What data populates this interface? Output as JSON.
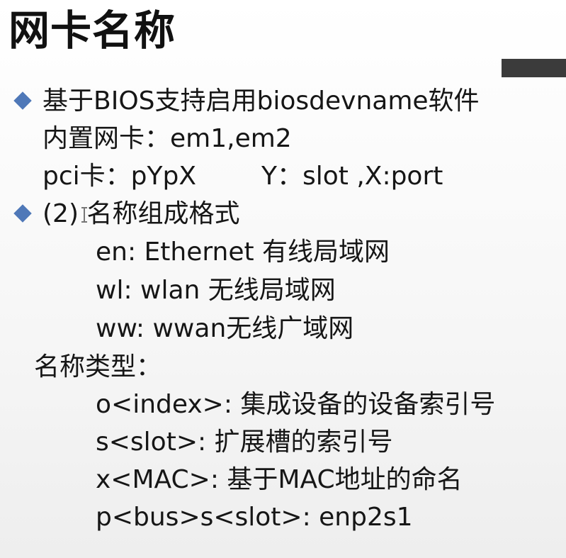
{
  "slide": {
    "title": "网卡名称",
    "lines": {
      "l1": "基于BIOS支持启用biosdevname软件",
      "l2": "内置网卡：em1,em2",
      "l3a": "pci卡：pYpX",
      "l3b": "Y：slot ,X:port",
      "l4": "(2) 名称组成格式",
      "l5": "en: Ethernet 有线局域网",
      "l6": "wl: wlan 无线局域网",
      "l7": "ww: wwan无线广域网",
      "l8": "名称类型：",
      "l9": "o<index>: 集成设备的设备索引号",
      "l10": "s<slot>: 扩展槽的索引号",
      "l11": "x<MAC>: 基于MAC地址的命名",
      "l12": "p<bus>s<slot>: enp2s1"
    }
  },
  "icons": {
    "bullet": "diamond-bullet-icon",
    "cursor": "text-cursor-icon"
  },
  "colors": {
    "bullet": "#4f78b8",
    "title_bar": "#3b3b3b",
    "text": "#161616"
  }
}
